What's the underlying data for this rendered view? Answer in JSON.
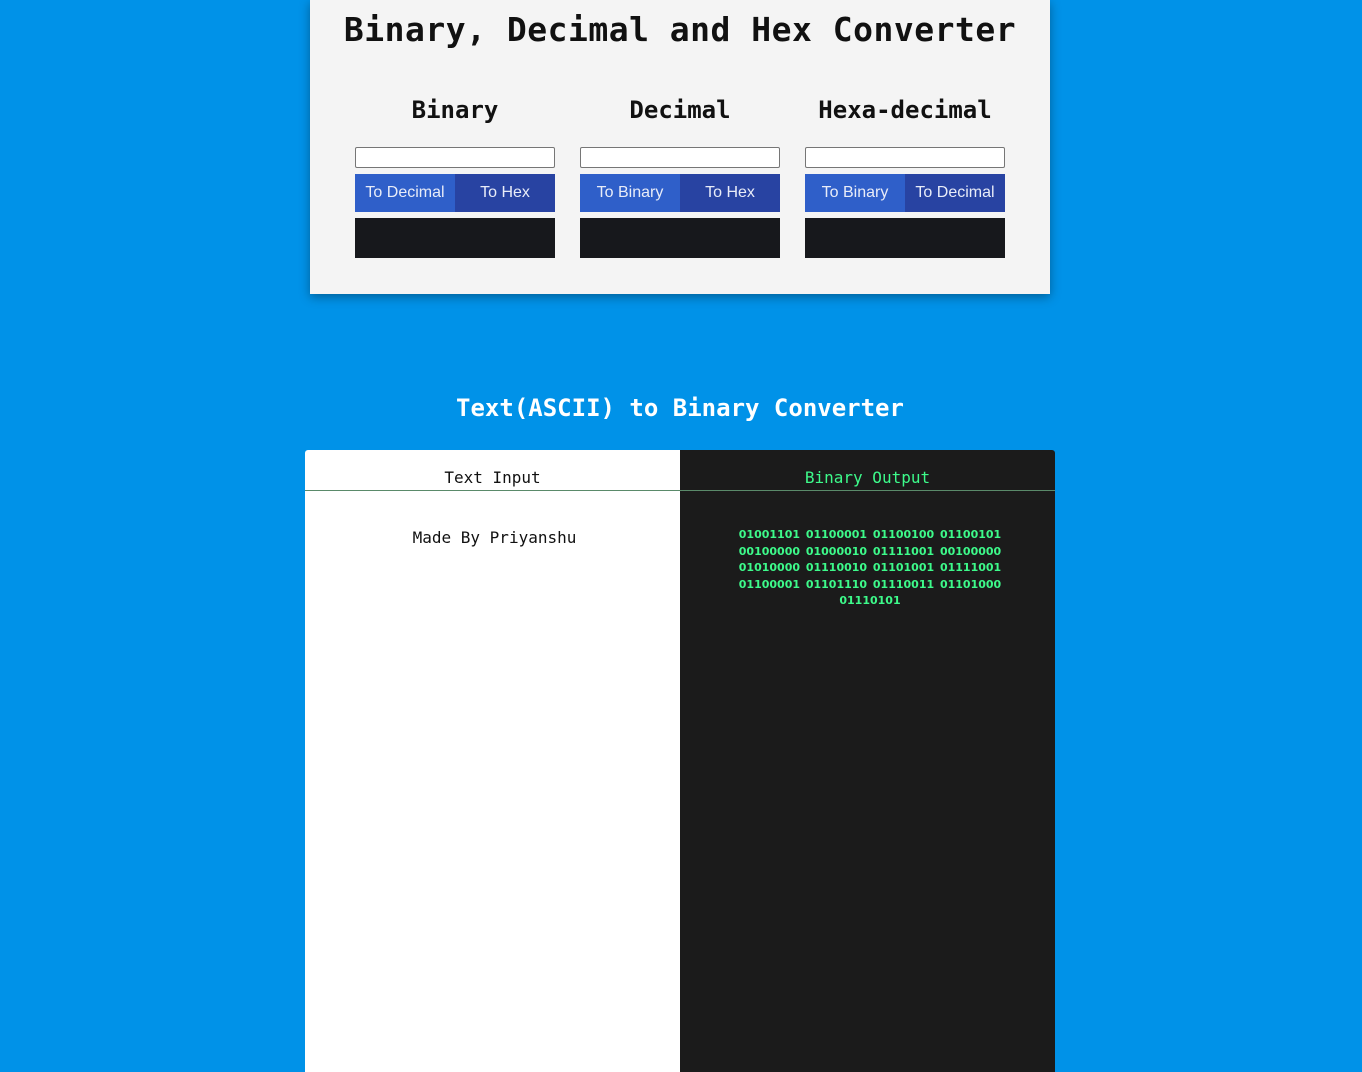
{
  "converter": {
    "title": "Binary, Decimal and Hex Converter",
    "columns": [
      {
        "heading": "Binary",
        "input_value": "",
        "buttons": [
          "To Decimal",
          "To Hex"
        ],
        "result": ""
      },
      {
        "heading": "Decimal",
        "input_value": "",
        "buttons": [
          "To Binary",
          "To Hex"
        ],
        "result": ""
      },
      {
        "heading": "Hexa-decimal",
        "input_value": "",
        "buttons": [
          "To Binary",
          "To Decimal"
        ],
        "result": ""
      }
    ]
  },
  "ascii": {
    "title": "Text(ASCII) to Binary Converter",
    "input_heading": "Text Input",
    "input_value": "Made By Priyanshu",
    "output_heading": "Binary Output",
    "output_value": "01001101 01100001 01100100 01100101 00100000 01000010 01111001 00100000 01010000 01110010 01101001 01111001 01100001 01101110 01110011 01101000 01110101"
  },
  "colors": {
    "page_background": "#0092e8",
    "card_background": "#f4f4f4",
    "button_light": "#2f5fc9",
    "button_dark": "#2843a2",
    "result_box": "#17181c",
    "output_panel": "#1b1b1b",
    "output_text": "#3dfa8a"
  }
}
